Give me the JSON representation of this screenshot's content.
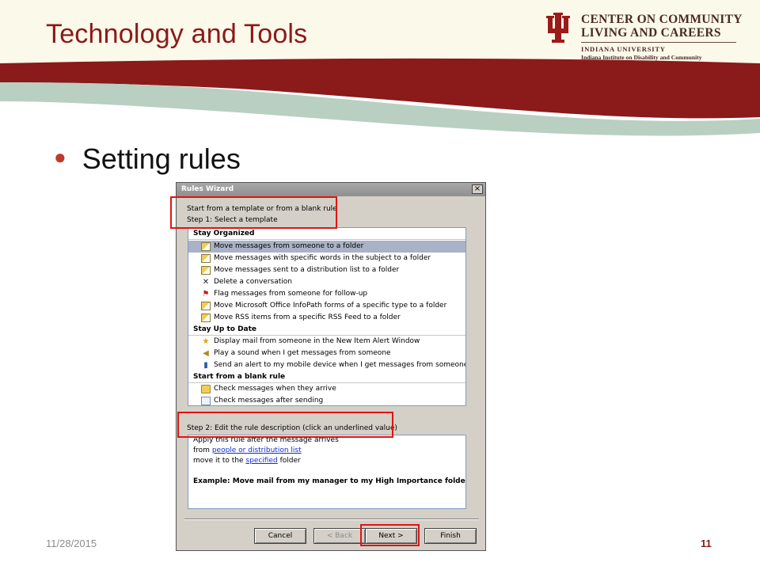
{
  "slide": {
    "title": "Technology and Tools",
    "bullet": "Setting rules",
    "footer_date": "11/28/2015",
    "page_number": "11",
    "logo": {
      "line1": "CENTER ON COMMUNITY",
      "line2": "LIVING AND CAREERS",
      "line3": "INDIANA UNIVERSITY",
      "line4": "Indiana Institute on Disability and Community",
      "icon": "iu-trident-icon"
    },
    "colors": {
      "accent": "#8b1a1a",
      "band_green": "#b9cfc2",
      "highlight": "#e01414"
    }
  },
  "dialog": {
    "title": "Rules Wizard",
    "close": "×",
    "step1_line1": "Start from a template or from a blank rule",
    "step1_line2": "Step 1: Select a template",
    "templates": {
      "group1": "Stay Organized",
      "g1_items": [
        {
          "label": "Move messages from someone to a folder",
          "icon": "envelope-folder-icon"
        },
        {
          "label": "Move messages with specific words in the subject to a folder",
          "icon": "envelope-folder-icon"
        },
        {
          "label": "Move messages sent to a distribution list to a folder",
          "icon": "envelope-folder-icon"
        },
        {
          "label": "Delete a conversation",
          "icon": "delete-x-icon"
        },
        {
          "label": "Flag messages from someone for follow-up",
          "icon": "flag-icon"
        },
        {
          "label": "Move Microsoft Office InfoPath forms of a specific type to a folder",
          "icon": "envelope-folder-icon"
        },
        {
          "label": "Move RSS items from a specific RSS Feed to a folder",
          "icon": "envelope-folder-icon"
        }
      ],
      "group2": "Stay Up to Date",
      "g2_items": [
        {
          "label": "Display mail from someone in the New Item Alert Window",
          "icon": "alert-star-icon"
        },
        {
          "label": "Play a sound when I get messages from someone",
          "icon": "speaker-icon"
        },
        {
          "label": "Send an alert to my mobile device when I get messages from someone",
          "icon": "mobile-device-icon"
        }
      ],
      "group3": "Start from a blank rule",
      "g3_items": [
        {
          "label": "Check messages when they arrive",
          "icon": "envelope-icon"
        },
        {
          "label": "Check messages after sending",
          "icon": "sent-envelope-icon"
        }
      ]
    },
    "step2_label": "Step 2: Edit the rule description (click an underlined value)",
    "rule": {
      "line1": "Apply this rule after the message arrives",
      "line2_prefix": "from ",
      "line2_link": "people or distribution list",
      "line3_prefix": "move it to the ",
      "line3_link": "specified",
      "line3_suffix": " folder",
      "example": "Example: Move mail from my manager to my High Importance folder"
    },
    "buttons": {
      "cancel": "Cancel",
      "back": "< Back",
      "next": "Next >",
      "finish": "Finish"
    }
  }
}
